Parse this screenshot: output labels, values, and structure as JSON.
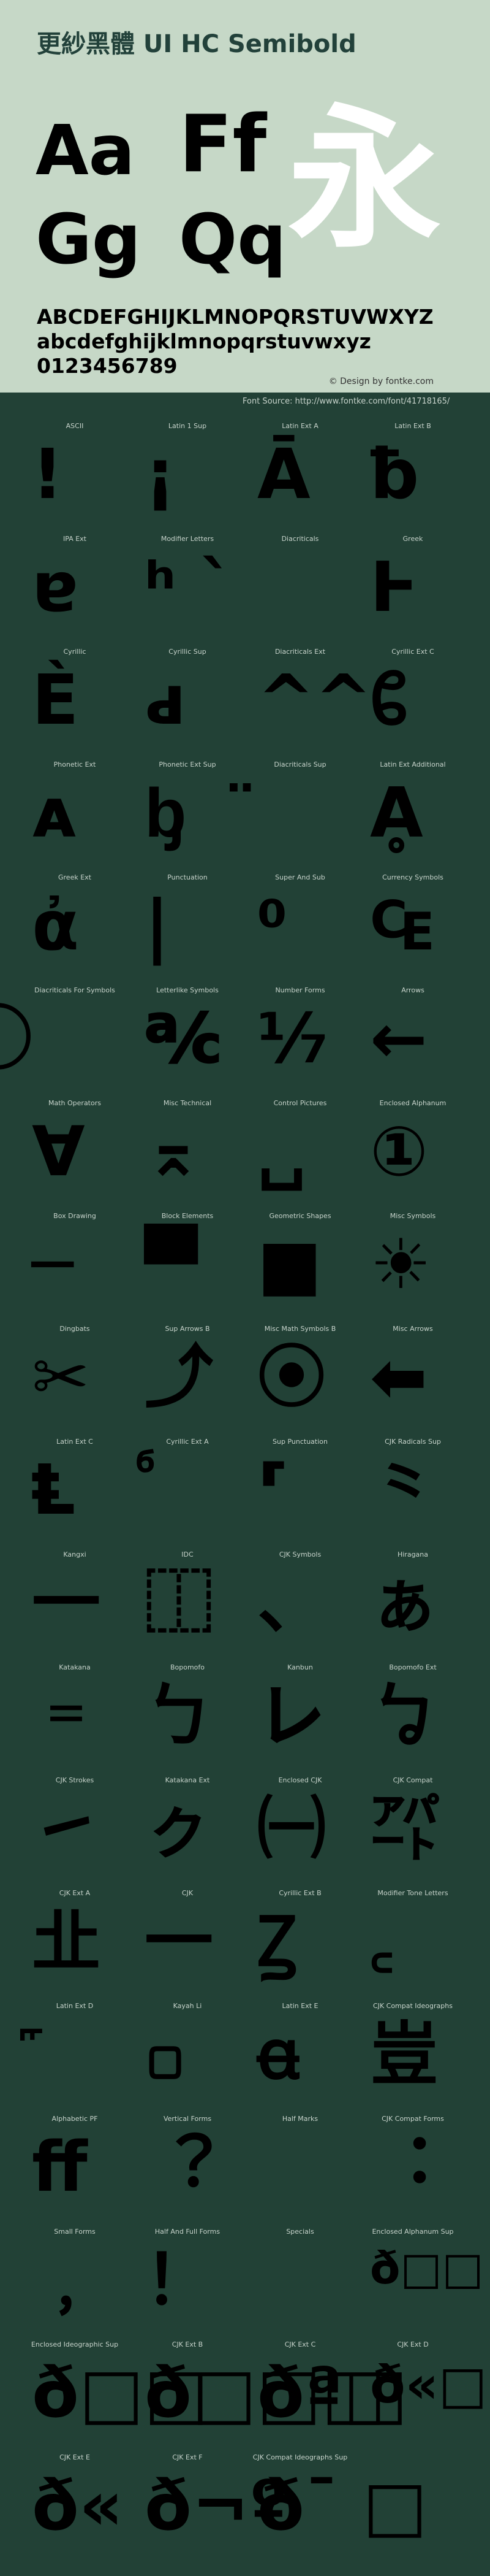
{
  "header": {
    "title": "更紗黑體 UI HC Semibold",
    "samples": [
      "Aa",
      "Ff",
      "Gg",
      "Qq"
    ],
    "hero_char": "永",
    "uppercase": "ABCDEFGHIJKLMNOPQRSTUVWXYZ",
    "lowercase": "abcdefghijklmnopqrstuvwxyz",
    "digits": "0123456789",
    "credit": "© Design by fontke.com",
    "source": "Font Source: http://www.fontke.com/font/41718165/"
  },
  "colors": {
    "header_bg": "#c6d8c7",
    "body_bg": "#224136",
    "title": "#22413a",
    "glyph": "#000000",
    "hero": "#ffffff"
  },
  "blocks": [
    {
      "label": "ASCII",
      "glyph": "!"
    },
    {
      "label": "Latin 1 Sup",
      "glyph": "¡"
    },
    {
      "label": "Latin Ext A",
      "glyph": "Ā"
    },
    {
      "label": "Latin Ext B",
      "glyph": "ƀ"
    },
    {
      "label": "IPA Ext",
      "glyph": "ɐ"
    },
    {
      "label": "Modifier Letters",
      "glyph": "ʰ ˋ"
    },
    {
      "label": "Diacriticals",
      "glyph": ""
    },
    {
      "label": "Greek",
      "glyph": "Ͱ"
    },
    {
      "label": "Cyrillic",
      "glyph": "Ѐ"
    },
    {
      "label": "Cyrillic Sup",
      "glyph": "ԁ"
    },
    {
      "label": "Diacriticals Ext",
      "glyph": "^^"
    },
    {
      "label": "Cyrillic Ext C",
      "glyph": "ᲀ"
    },
    {
      "label": "Phonetic Ext",
      "glyph": "ᴀ"
    },
    {
      "label": "Phonetic Ext Sup",
      "glyph": "ᶀ"
    },
    {
      "label": "Diacriticals Sup",
      "glyph": "̈"
    },
    {
      "label": "Latin Ext Additional",
      "glyph": "Ḁ"
    },
    {
      "label": "Greek Ext",
      "glyph": "ἀ"
    },
    {
      "label": "Punctuation",
      "glyph": "|"
    },
    {
      "label": "Super And Sub",
      "glyph": "⁰"
    },
    {
      "label": "Currency Symbols",
      "glyph": "₠"
    },
    {
      "label": "Diacriticals For Symbols",
      "glyph": "⃝"
    },
    {
      "label": "Letterlike Symbols",
      "glyph": "℀"
    },
    {
      "label": "Number Forms",
      "glyph": "⅐"
    },
    {
      "label": "Arrows",
      "glyph": "←"
    },
    {
      "label": "Math Operators",
      "glyph": "∀"
    },
    {
      "label": "Misc Technical",
      "glyph": "⌅"
    },
    {
      "label": "Control Pictures",
      "glyph": "␣"
    },
    {
      "label": "Enclosed Alphanum",
      "glyph": "①"
    },
    {
      "label": "Box Drawing",
      "glyph": "─"
    },
    {
      "label": "Block Elements",
      "glyph": "▀"
    },
    {
      "label": "Geometric Shapes",
      "glyph": "■"
    },
    {
      "label": "Misc Symbols",
      "glyph": "☀"
    },
    {
      "label": "Dingbats",
      "glyph": "✂"
    },
    {
      "label": "Sup Arrows B",
      "glyph": "⤴"
    },
    {
      "label": "Misc Math Symbols B",
      "glyph": "⦿"
    },
    {
      "label": "Misc Arrows",
      "glyph": "⬅"
    },
    {
      "label": "Latin Ext C",
      "glyph": "Ⱡ"
    },
    {
      "label": "Cyrillic Ext A",
      "glyph": "ⷠ"
    },
    {
      "label": "Sup Punctuation",
      "glyph": "⸢"
    },
    {
      "label": "CJK Radicals Sup",
      "glyph": "⺀"
    },
    {
      "label": "Kangxi",
      "glyph": "⼀"
    },
    {
      "label": "IDC",
      "glyph": "⿰"
    },
    {
      "label": "CJK Symbols",
      "glyph": "、"
    },
    {
      "label": "Hiragana",
      "glyph": "ぁ"
    },
    {
      "label": "Katakana",
      "glyph": "゠"
    },
    {
      "label": "Bopomofo",
      "glyph": "ㄅ"
    },
    {
      "label": "Kanbun",
      "glyph": "㆑"
    },
    {
      "label": "Bopomofo Ext",
      "glyph": "ㆠ"
    },
    {
      "label": "CJK Strokes",
      "glyph": "㇀"
    },
    {
      "label": "Katakana Ext",
      "glyph": "ㇰ"
    },
    {
      "label": "Enclosed CJK",
      "glyph": "㈠"
    },
    {
      "label": "CJK Compat",
      "glyph": "㌀"
    },
    {
      "label": "CJK Ext A",
      "glyph": "㐀"
    },
    {
      "label": "CJK",
      "glyph": "一"
    },
    {
      "label": "Cyrillic Ext B",
      "glyph": "Ꙁ"
    },
    {
      "label": "Modifier Tone Letters",
      "glyph": "꜀"
    },
    {
      "label": "Latin Ext D",
      "glyph": "꜠"
    },
    {
      "label": "Kayah Li",
      "glyph": "꤀"
    },
    {
      "label": "Latin Ext E",
      "glyph": "ꬰ"
    },
    {
      "label": "CJK Compat Ideographs",
      "glyph": "豈"
    },
    {
      "label": "Alphabetic PF",
      "glyph": "ﬀ"
    },
    {
      "label": "Vertical Forms",
      "glyph": "︖"
    },
    {
      "label": "Half Marks",
      "glyph": ""
    },
    {
      "label": "CJK Compat Forms",
      "glyph": "︓"
    },
    {
      "label": "Small Forms",
      "glyph": "﹐"
    },
    {
      "label": "Half And Full Forms",
      "glyph": "！"
    },
    {
      "label": "Specials",
      "glyph": "￼"
    },
    {
      "label": "Enclosed Alphanum Sup",
      "glyph": "ð□□"
    },
    {
      "label": "Enclosed Ideographic Sup",
      "glyph": "ð□□"
    },
    {
      "label": "CJK Ext B",
      "glyph": "ð□□□"
    },
    {
      "label": "CJK Ext C",
      "glyph": "ðª□"
    },
    {
      "label": "CJK Ext D",
      "glyph": "ð«□"
    },
    {
      "label": "CJK Ext E",
      "glyph": "ð«"
    },
    {
      "label": "CJK Ext F",
      "glyph": "ð¬º"
    },
    {
      "label": "CJK Compat Ideographs Sup",
      "glyph": "ð¯ □"
    }
  ]
}
